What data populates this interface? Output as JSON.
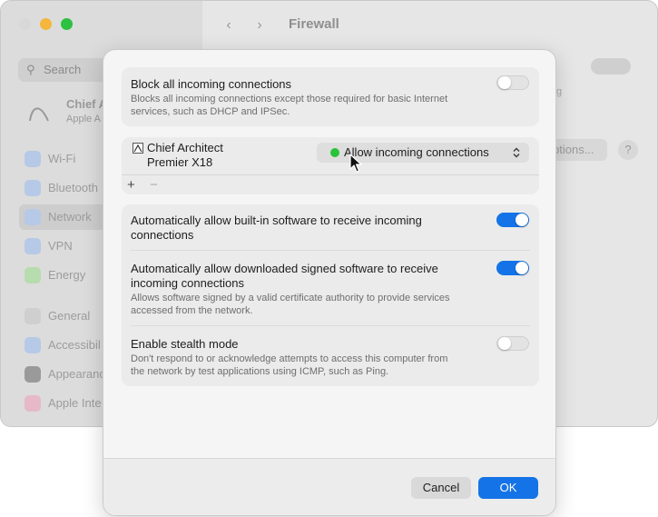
{
  "background_window": {
    "title": "Firewall",
    "search_placeholder": "Search",
    "account": {
      "name": "Chief A",
      "subtitle": "Apple A"
    },
    "sidebar_items": [
      {
        "label": "Wi-Fi",
        "icon": "wifi-icon",
        "color": "#b6c9e6"
      },
      {
        "label": "Bluetooth",
        "icon": "bluetooth-icon",
        "color": "#b6c9e6"
      },
      {
        "label": "Network",
        "icon": "globe-icon",
        "color": "#b6c9e6",
        "selected": true
      },
      {
        "label": "VPN",
        "icon": "vpn-icon",
        "color": "#b6c9e6"
      },
      {
        "label": "Energy",
        "icon": "bolt-icon",
        "color": "#b7dcae"
      },
      {
        "label": "General",
        "icon": "gear-icon",
        "color": "#cfcfcf"
      },
      {
        "label": "Accessibil",
        "icon": "accessibility-icon",
        "color": "#b6c9e6"
      },
      {
        "label": "Appearanc",
        "icon": "appearance-icon",
        "color": "#9a9a9a"
      },
      {
        "label": "Apple Inte",
        "icon": "apple-intelligence-icon",
        "color": "#e6b8c8"
      }
    ],
    "right_text": "g",
    "options_label": "ptions...",
    "help_label": "?"
  },
  "sheet": {
    "block_all": {
      "title": "Block all incoming connections",
      "description_line1": "Blocks all incoming connections except those required for basic Internet",
      "description_line2": "services, such as DHCP and IPSec.",
      "enabled": false
    },
    "app_list": {
      "apps": [
        {
          "name_line1": "Chief Architect",
          "name_line2": "Premier X18",
          "setting": "Allow incoming connections",
          "status_color": "#29c23a"
        }
      ],
      "add_label": "+",
      "remove_label": "−"
    },
    "builtin": {
      "title_line1": "Automatically allow built-in software to receive incoming",
      "title_line2": "connections",
      "enabled": true
    },
    "signed": {
      "title_line1": "Automatically allow downloaded signed software to receive",
      "title_line2": "incoming connections",
      "description_line1": "Allows software signed by a valid certificate authority to provide services",
      "description_line2": "accessed from the network.",
      "enabled": true
    },
    "stealth": {
      "title": "Enable stealth mode",
      "description_line1": "Don't respond to or acknowledge attempts to access this computer from",
      "description_line2": "the network by test applications using ICMP, such as Ping.",
      "enabled": false
    },
    "buttons": {
      "cancel": "Cancel",
      "ok": "OK"
    },
    "accent_color": "#1473e6"
  }
}
